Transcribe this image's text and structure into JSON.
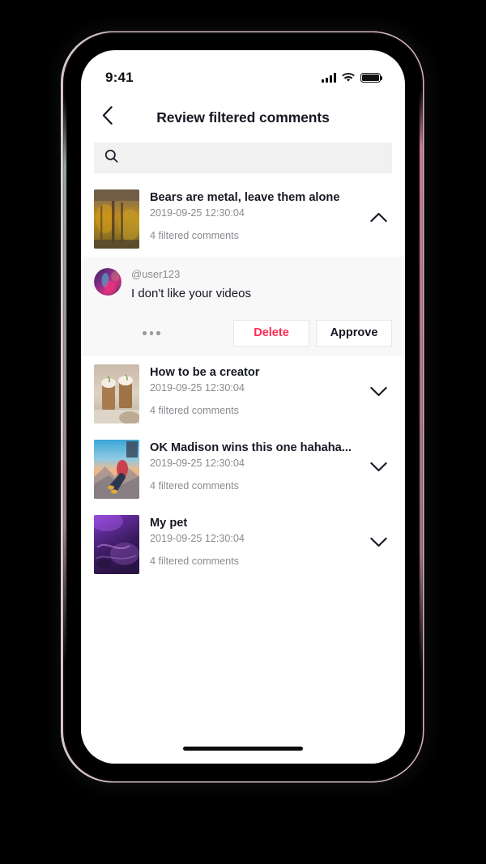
{
  "status_bar": {
    "time": "9:41",
    "signal_icon": "cellular-signal-icon",
    "wifi_icon": "wifi-icon",
    "battery_icon": "battery-full-icon"
  },
  "header": {
    "back_icon": "chevron-left-icon",
    "title": "Review filtered comments"
  },
  "search": {
    "icon": "search-icon",
    "value": "",
    "placeholder": ""
  },
  "colors": {
    "accent_delete": "#fe2c55",
    "text_primary": "#161823",
    "text_secondary": "#8a8b91",
    "search_bg": "#f1f1f2",
    "panel_bg": "#f8f8f8",
    "button_border": "#e7e7e9"
  },
  "videos": [
    {
      "title": "Bears are metal, leave them alone",
      "date": "2019-09-25 12:30:04",
      "filtered_count": "4 filtered comments",
      "expanded": true,
      "chevron_icon": "chevron-up-icon",
      "thumbnail": "autumn-forest-thumbnail"
    },
    {
      "title": "How to be a creator",
      "date": "2019-09-25 12:30:04",
      "filtered_count": "4 filtered comments",
      "expanded": false,
      "chevron_icon": "chevron-down-icon",
      "thumbnail": "iced-coffee-thumbnail"
    },
    {
      "title": "OK Madison wins this one hahaha...",
      "date": "2019-09-25 12:30:04",
      "filtered_count": "4 filtered comments",
      "expanded": false,
      "chevron_icon": "chevron-down-icon",
      "thumbnail": "mountain-sunset-thumbnail"
    },
    {
      "title": "My pet",
      "date": "2019-09-25 12:30:04",
      "filtered_count": "4 filtered comments",
      "expanded": false,
      "chevron_icon": "chevron-down-icon",
      "thumbnail": "purple-abstract-thumbnail"
    }
  ],
  "expanded_comment": {
    "avatar_icon": "user-avatar",
    "username": "@user123",
    "text": "I don't like your videos",
    "more_icon": "more-options-icon",
    "delete_label": "Delete",
    "approve_label": "Approve"
  },
  "home_indicator": "home-indicator-bar"
}
